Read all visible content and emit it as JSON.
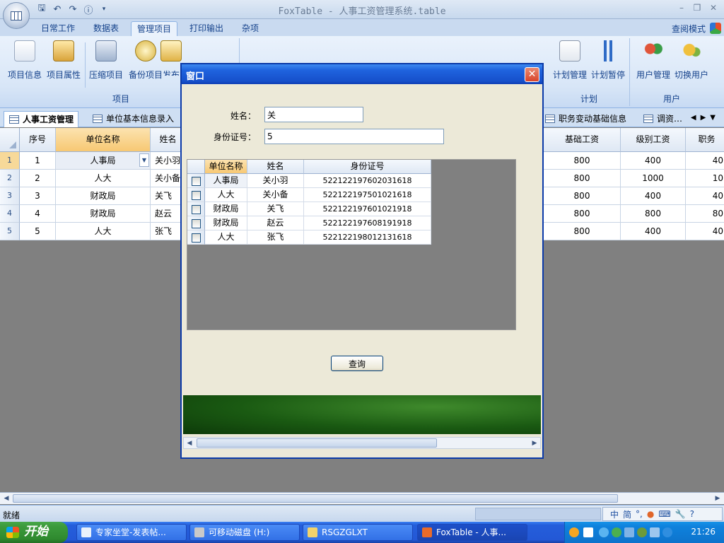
{
  "window": {
    "title": "FoxTable - 人事工资管理系统.table"
  },
  "ribbon": {
    "tabs": [
      {
        "label": "日常工作"
      },
      {
        "label": "数据表"
      },
      {
        "label": "管理项目"
      },
      {
        "label": "打印输出"
      },
      {
        "label": "杂项"
      }
    ],
    "active_tab": "管理项目",
    "view_mode": "查阅模式",
    "buttons": {
      "project_info": "项目信息",
      "project_props": "项目属性",
      "compress": "压缩项目",
      "backup": "备份项目",
      "publish": "发布",
      "plan_manage": "计划管理",
      "plan_pause": "计划暂停",
      "user_manage": "用户管理",
      "switch_user": "切换用户"
    },
    "groups": {
      "project": "项目",
      "plan": "计划",
      "user": "用户"
    }
  },
  "doc_tabs": [
    {
      "label": "人事工资管理"
    },
    {
      "label": "单位基本信息录入"
    },
    {
      "label": "职务变动基础信息"
    },
    {
      "label": "调资…"
    }
  ],
  "main_table": {
    "columns": [
      "序号",
      "单位名称",
      "姓名",
      "基础工资",
      "级别工资",
      "职务"
    ],
    "rows": [
      {
        "num": "1",
        "seq": "1",
        "unit": "人事局",
        "name": "关小羽",
        "base": "800",
        "level": "400",
        "duty": "40"
      },
      {
        "num": "2",
        "seq": "2",
        "unit": "人大",
        "name": "关小备",
        "base": "800",
        "level": "1000",
        "duty": "10"
      },
      {
        "num": "3",
        "seq": "3",
        "unit": "财政局",
        "name": "关飞",
        "base": "800",
        "level": "400",
        "duty": "40"
      },
      {
        "num": "4",
        "seq": "4",
        "unit": "财政局",
        "name": "赵云",
        "base": "800",
        "level": "800",
        "duty": "80"
      },
      {
        "num": "5",
        "seq": "5",
        "unit": "人大",
        "name": "张飞",
        "base": "800",
        "level": "400",
        "duty": "40"
      }
    ]
  },
  "dialog": {
    "title": "窗口",
    "name_label": "姓名：",
    "name_value": "关",
    "id_label": "身份证号：",
    "id_value": "5",
    "query_button": "查询",
    "columns": [
      "单位名称",
      "姓名",
      "身份证号"
    ],
    "rows": [
      {
        "unit": "人事局",
        "name": "关小羽",
        "id": "522122197602031618"
      },
      {
        "unit": "人大",
        "name": "关小备",
        "id": "522122197501021618"
      },
      {
        "unit": "财政局",
        "name": "关飞",
        "id": "522122197601021918"
      },
      {
        "unit": "财政局",
        "name": "赵云",
        "id": "522122197608191918"
      },
      {
        "unit": "人大",
        "name": "张飞",
        "id": "522122198012131618"
      }
    ]
  },
  "status": {
    "text": "就绪"
  },
  "taskbar": {
    "start": "开始",
    "items": [
      {
        "label": "专家坐堂-发表帖..."
      },
      {
        "label": "可移动磁盘 (H:)"
      },
      {
        "label": "RSGZGLXT"
      },
      {
        "label": "FoxTable - 人事..."
      }
    ],
    "clock": "21:26"
  },
  "colors": {
    "ribbon_text": "#15428b",
    "selected_header": "#f7c873",
    "dialog_title": "#1f63de",
    "taskbar": "#245edb"
  }
}
